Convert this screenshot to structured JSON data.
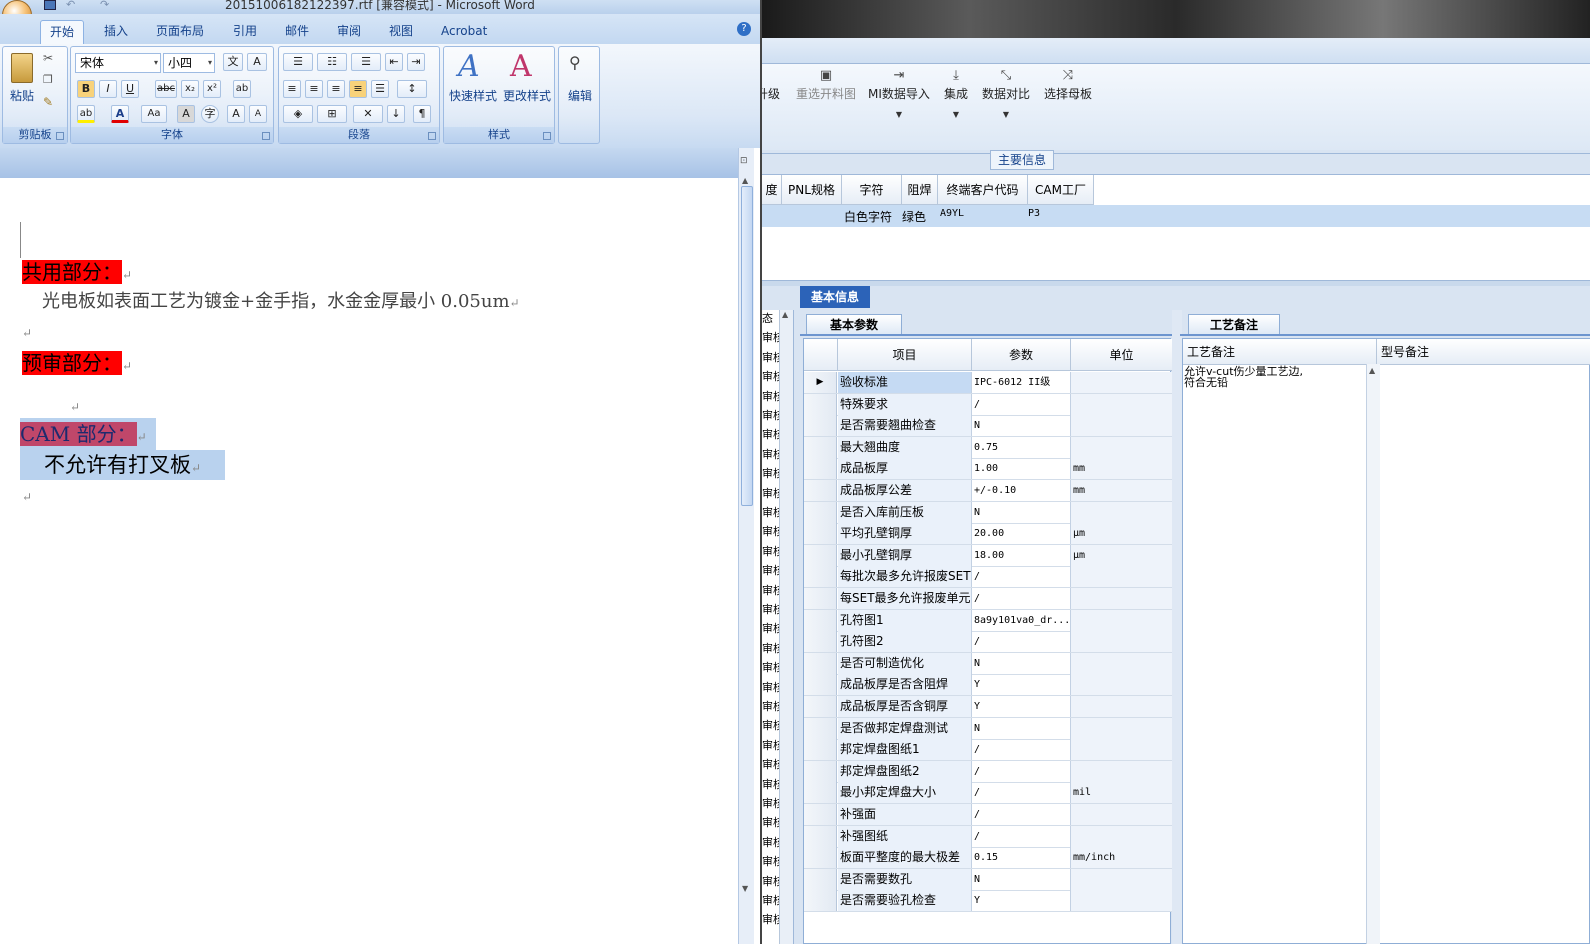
{
  "word": {
    "title": "20151006182122397.rtf [兼容模式] - Microsoft Word",
    "tabs": [
      "开始",
      "插入",
      "页面布局",
      "引用",
      "邮件",
      "审阅",
      "视图",
      "Acrobat"
    ],
    "groups": {
      "clipboard": "剪贴板",
      "font": "字体",
      "paragraph": "段落",
      "styles": "样式"
    },
    "paste": "粘贴",
    "font_name": "宋体",
    "font_size": "小四",
    "quick_styles": "快速样式",
    "change_styles": "更改样式",
    "edit": "编辑",
    "doc": {
      "h1": "共用部分：",
      "line1": "光电板如表面工艺为镀金+金手指，水金金厚最小 0.05um",
      "h2": "预审部分：",
      "h3": "CAM 部分：",
      "line3": "不允许有打叉板",
      "para_mark": "↵"
    }
  },
  "app": {
    "toolbar": [
      {
        "label": "升级",
        "icon": "upgrade-icon",
        "disabled": false
      },
      {
        "label": "重选开料图",
        "icon": "image-icon",
        "disabled": true
      },
      {
        "label": "MI数据导入",
        "icon": "import-icon",
        "disabled": false
      },
      {
        "label": "集成",
        "icon": "download-icon",
        "disabled": false
      },
      {
        "label": "数据对比",
        "icon": "compare-icon",
        "disabled": false
      },
      {
        "label": "选择母板",
        "icon": "shuffle-icon",
        "disabled": false
      }
    ],
    "main_info": "主要信息",
    "grid1": {
      "headers": [
        "度",
        "PNL规格",
        "字符",
        "阻焊",
        "终端客户代码",
        "CAM工厂"
      ],
      "row": [
        "白色字符",
        "绿色",
        "A9YL",
        "P3"
      ]
    },
    "basic_info": "基本信息",
    "left_col": [
      "态",
      "审核",
      "审核",
      "审核",
      "审核",
      "审核",
      "审核",
      "审核",
      "审核",
      "审核",
      "审核",
      "审核",
      "审核",
      "审核",
      "审核",
      "审核",
      "审核",
      "审核",
      "审核",
      "审核",
      "审核",
      "审核",
      "审核",
      "审核",
      "审核",
      "审核",
      "审核",
      "审核",
      "审核",
      "审核",
      "审核",
      "审核"
    ],
    "params": {
      "tab": "基本参数",
      "headers": [
        "项目",
        "参数",
        "单位"
      ],
      "rows": [
        {
          "item": "验收标准",
          "value": "IPC-6012 II级",
          "unit": ""
        },
        {
          "item": "特殊要求",
          "value": "/",
          "unit": ""
        },
        {
          "item": "是否需要翘曲检查",
          "value": "N",
          "unit": ""
        },
        {
          "item": "最大翘曲度",
          "value": "0.75",
          "unit": ""
        },
        {
          "item": "成品板厚",
          "value": "1.00",
          "unit": "mm"
        },
        {
          "item": "成品板厚公差",
          "value": "+/-0.10",
          "unit": "mm"
        },
        {
          "item": "是否入库前压板",
          "value": "N",
          "unit": ""
        },
        {
          "item": "平均孔壁铜厚",
          "value": "20.00",
          "unit": "μm"
        },
        {
          "item": "最小孔壁铜厚",
          "value": "18.00",
          "unit": "μm"
        },
        {
          "item": "每批次最多允许报废SET",
          "value": "/",
          "unit": ""
        },
        {
          "item": "每SET最多允许报废单元",
          "value": "/",
          "unit": ""
        },
        {
          "item": "孔符图1",
          "value": "8a9y101va0_dr...",
          "unit": ""
        },
        {
          "item": "孔符图2",
          "value": "/",
          "unit": ""
        },
        {
          "item": "是否可制造优化",
          "value": "N",
          "unit": ""
        },
        {
          "item": "成品板厚是否含阻焊",
          "value": "Y",
          "unit": ""
        },
        {
          "item": "成品板厚是否含铜厚",
          "value": "Y",
          "unit": ""
        },
        {
          "item": "是否做邦定焊盘测试",
          "value": "N",
          "unit": ""
        },
        {
          "item": "邦定焊盘图纸1",
          "value": "/",
          "unit": ""
        },
        {
          "item": "邦定焊盘图纸2",
          "value": "/",
          "unit": ""
        },
        {
          "item": "最小邦定焊盘大小",
          "value": "/",
          "unit": "mil"
        },
        {
          "item": "补强面",
          "value": "/",
          "unit": ""
        },
        {
          "item": "补强图纸",
          "value": "/",
          "unit": ""
        },
        {
          "item": "板面平整度的最大极差",
          "value": "0.15",
          "unit": "mm/inch"
        },
        {
          "item": "是否需要数孔",
          "value": "N",
          "unit": ""
        },
        {
          "item": "是否需要验孔检查",
          "value": "Y",
          "unit": ""
        }
      ]
    },
    "remarks": {
      "tab": "工艺备注",
      "headers": [
        "工艺备注",
        "型号备注"
      ],
      "text_line1": "允许v-cut伤少量工艺边,",
      "text_line2": "符合无铅"
    }
  }
}
